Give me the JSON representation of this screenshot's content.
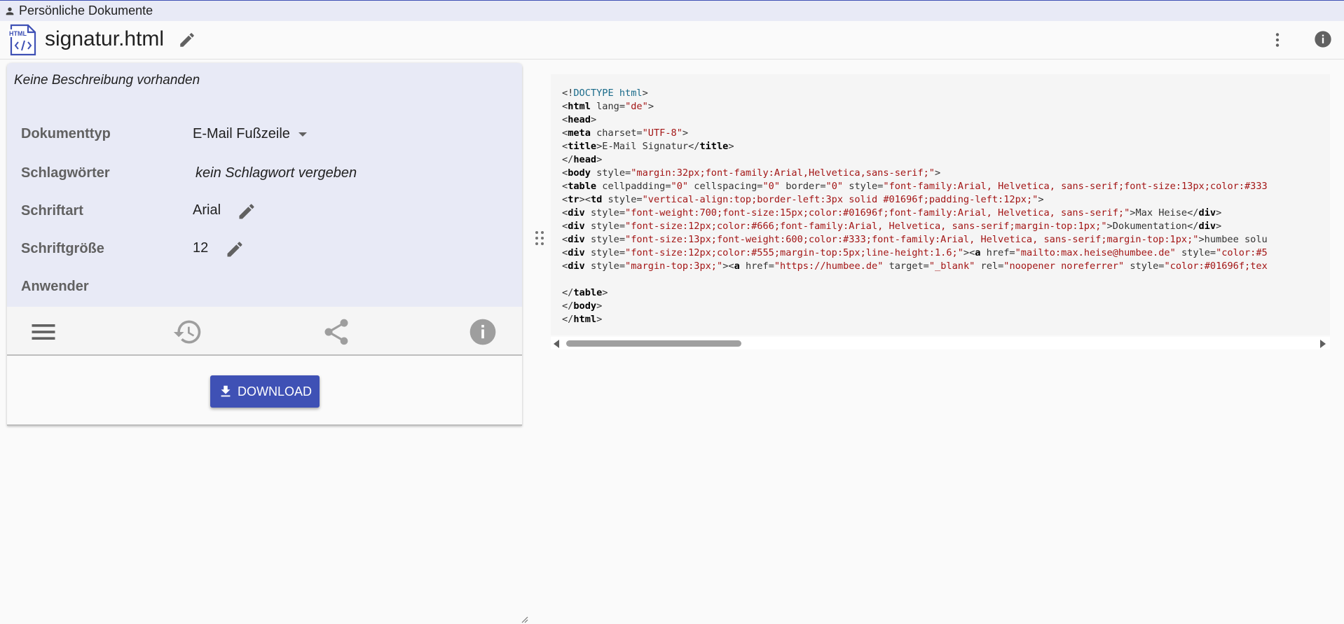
{
  "topbar": {
    "breadcrumb": "Persönliche Dokumente"
  },
  "header": {
    "file_icon_label": "HTML",
    "title": "signatur.html"
  },
  "details": {
    "description": "Keine Beschreibung vorhanden",
    "rows": [
      {
        "label": "Dokumenttyp",
        "value": "E-Mail Fußzeile"
      },
      {
        "label": "Schlagwörter",
        "value": "kein Schlagwort vergeben"
      },
      {
        "label": "Schriftart",
        "value": "Arial"
      },
      {
        "label": "Schriftgröße",
        "value": "12"
      },
      {
        "label": "Anwender",
        "value": ""
      }
    ]
  },
  "toolbar": {
    "icons": [
      "menu-icon",
      "history-icon",
      "share-icon",
      "info-icon"
    ]
  },
  "download": {
    "label": "DOWNLOAD"
  },
  "code": {
    "lines": [
      "<!DOCTYPE html>",
      "<html lang=\"de\">",
      "<head>",
      "<meta charset=\"UTF-8\">",
      "<title>E-Mail Signatur</title>",
      "</head>",
      "<body style=\"margin:32px;font-family:Arial,Helvetica,sans-serif;\">",
      "<table cellpadding=\"0\" cellspacing=\"0\" border=\"0\" style=\"font-family:Arial, Helvetica, sans-serif;font-size:13px;color:#333",
      "<tr><td style=\"vertical-align:top;border-left:3px solid #01696f;padding-left:12px;\">",
      "<div style=\"font-weight:700;font-size:15px;color:#01696f;font-family:Arial, Helvetica, sans-serif;\">Max Heise</div>",
      "<div style=\"font-size:12px;color:#666;font-family:Arial, Helvetica, sans-serif;margin-top:1px;\">Dokumentation</div>",
      "<div style=\"font-size:13px;font-weight:600;color:#333;font-family:Arial, Helvetica, sans-serif;margin-top:1px;\">humbee solu",
      "<div style=\"font-size:12px;color:#555;margin-top:5px;line-height:1.6;\"><a href=\"mailto:max.heise@humbee.de\" style=\"color:#5",
      "<div style=\"margin-top:3px;\"><a href=\"https://humbee.de\" target=\"_blank\" rel=\"noopener noreferrer\" style=\"color:#01696f;tex",
      "",
      "</table>",
      "</body>",
      "</html>"
    ]
  },
  "colors": {
    "accent": "#3f51b5",
    "panel_bg": "#e8eaf6",
    "code_string": "#a31515",
    "code_tag": "#000000"
  }
}
